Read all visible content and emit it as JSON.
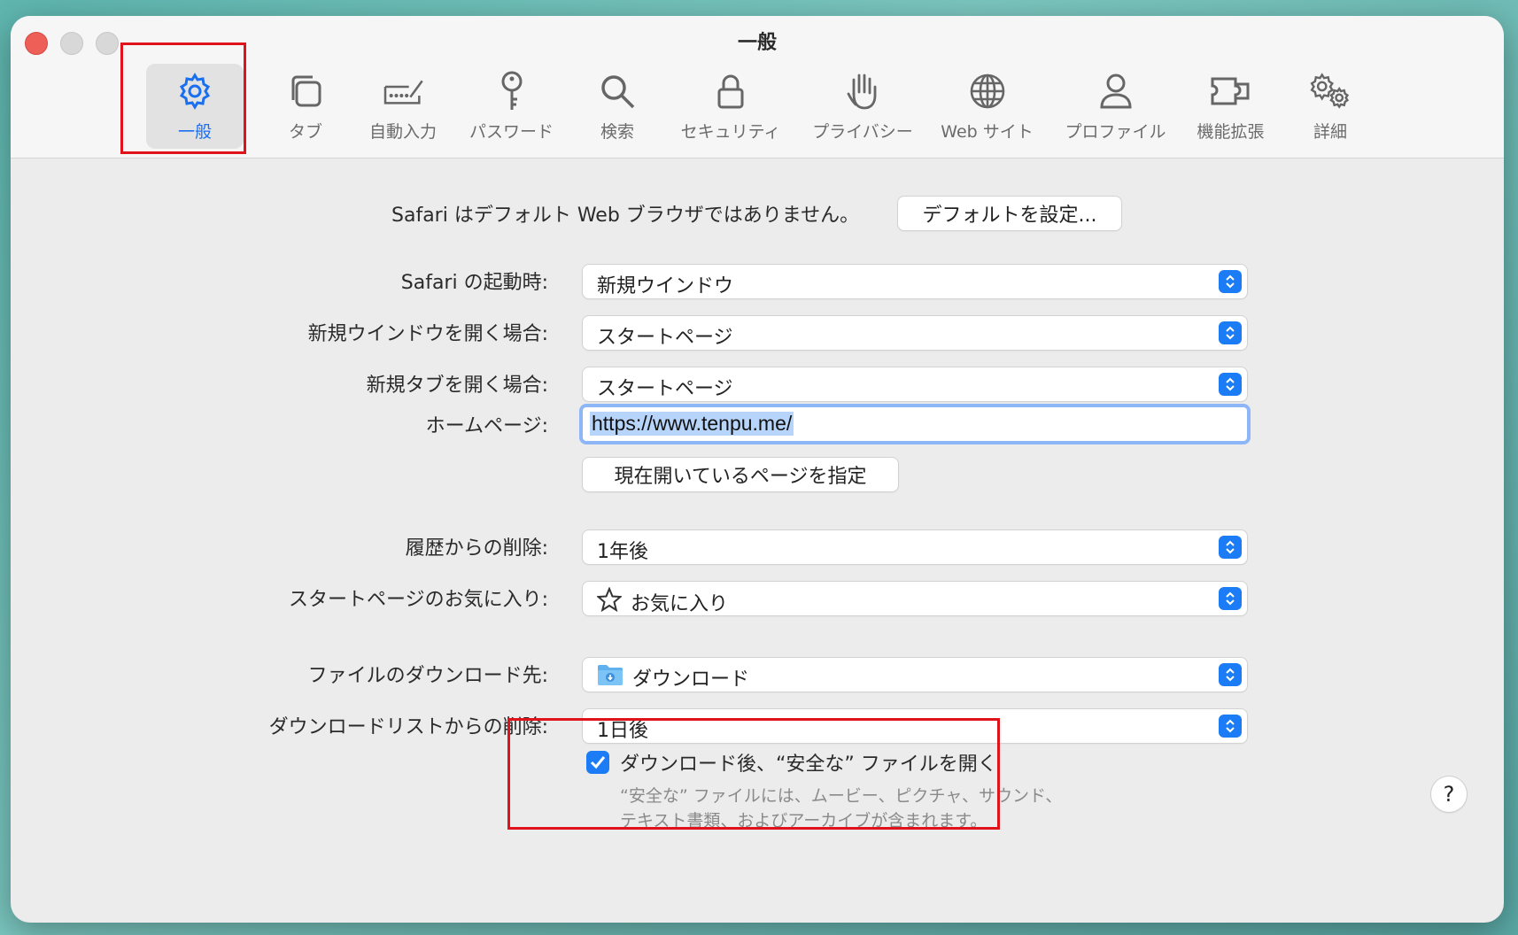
{
  "window": {
    "title": "一般"
  },
  "toolbar": {
    "items": [
      {
        "label": "一般",
        "icon": "gear-icon",
        "selected": true
      },
      {
        "label": "タブ",
        "icon": "tabs-icon"
      },
      {
        "label": "自動入力",
        "icon": "autofill-icon"
      },
      {
        "label": "パスワード",
        "icon": "key-icon"
      },
      {
        "label": "検索",
        "icon": "magnifier-icon"
      },
      {
        "label": "セキュリティ",
        "icon": "lock-icon"
      },
      {
        "label": "プライバシー",
        "icon": "hand-icon"
      },
      {
        "label": "Web サイト",
        "icon": "globe-icon"
      },
      {
        "label": "プロファイル",
        "icon": "person-icon"
      },
      {
        "label": "機能拡張",
        "icon": "puzzle-icon"
      },
      {
        "label": "詳細",
        "icon": "gears-icon"
      }
    ]
  },
  "default_browser": {
    "message": "Safari はデフォルト Web ブラウザではありません。",
    "button": "デフォルトを設定..."
  },
  "settings": {
    "launch": {
      "label": "Safari の起動時:",
      "value": "新規ウインドウ"
    },
    "new_window": {
      "label": "新規ウインドウを開く場合:",
      "value": "スタートページ"
    },
    "new_tab": {
      "label": "新規タブを開く場合:",
      "value": "スタートページ"
    },
    "homepage": {
      "label": "ホームページ:",
      "value": "https://www.tenpu.me/"
    },
    "set_current_button": "現在開いているページを指定",
    "history_remove": {
      "label": "履歴からの削除:",
      "value": "1年後"
    },
    "favorites": {
      "label": "スタートページのお気に入り:",
      "value": "お気に入り"
    },
    "download_location": {
      "label": "ファイルのダウンロード先:",
      "value": "ダウンロード"
    },
    "download_list_remove": {
      "label": "ダウンロードリストからの削除:",
      "value": "1日後"
    },
    "open_safe": {
      "label": "ダウンロード後、“安全な” ファイルを開く",
      "checked": true,
      "help": "“安全な” ファイルには、ムービー、ピクチャ、サウンド、テキスト書類、およびアーカイブが含まれます。"
    }
  },
  "help_button": "?",
  "colors": {
    "accent": "#1b7cf5",
    "highlight_box": "#e0131b",
    "selection": "#b7d5fb"
  }
}
